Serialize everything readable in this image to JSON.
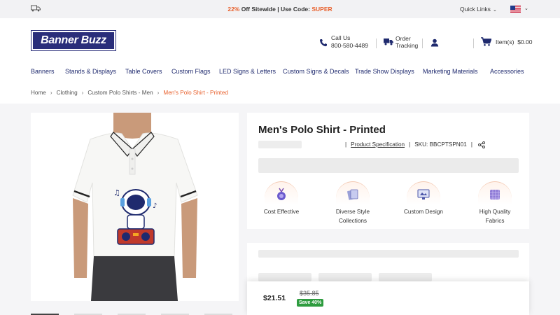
{
  "promo": {
    "percent": "22%",
    "text_mid": " Off Sitewide | Use Code: ",
    "code": "SUPER",
    "quick_links": "Quick Links"
  },
  "header": {
    "logo_part1": "Banner ",
    "logo_part2": "B",
    "logo_o": "u",
    "logo_part3": "zz",
    "call_label": "Call Us",
    "call_number": "800-580-4489",
    "order_line1": "Order",
    "order_line2": "Tracking",
    "cart_label": "Item(s)",
    "cart_total": "$0.00"
  },
  "nav": [
    "Banners",
    "Stands & Displays",
    "Table Covers",
    "Custom Flags",
    "LED Signs & Letters",
    "Custom Signs & Decals",
    "Trade Show Displays",
    "Marketing Materials",
    "Accessories"
  ],
  "breadcrumb": [
    "Home",
    "Clothing",
    "Custom Polo Shirts - Men",
    "Men's Polo Shirt - Printed"
  ],
  "product": {
    "title": "Men's Polo Shirt - Printed",
    "spec_link": "Product Specification",
    "sku": "SKU: BBCPTSPN01"
  },
  "features": [
    {
      "line1": "Cost Effective",
      "line2": "",
      "icon": "coin-medal-icon"
    },
    {
      "line1": "Diverse Style",
      "line2": "Collections",
      "icon": "cards-icon"
    },
    {
      "line1": "Custom Design",
      "line2": "",
      "icon": "monitor-design-icon"
    },
    {
      "line1": "High Quality",
      "line2": "Fabrics",
      "icon": "fabric-icon"
    }
  ],
  "pricing": {
    "price": "$21.51",
    "old_price": "$35.85",
    "save": "Save 40%"
  },
  "colors": {
    "accent": "#e8602c",
    "brand": "#2a2e7a",
    "nav_text": "#1f2a6e",
    "save_badge": "#2e9c3f"
  }
}
